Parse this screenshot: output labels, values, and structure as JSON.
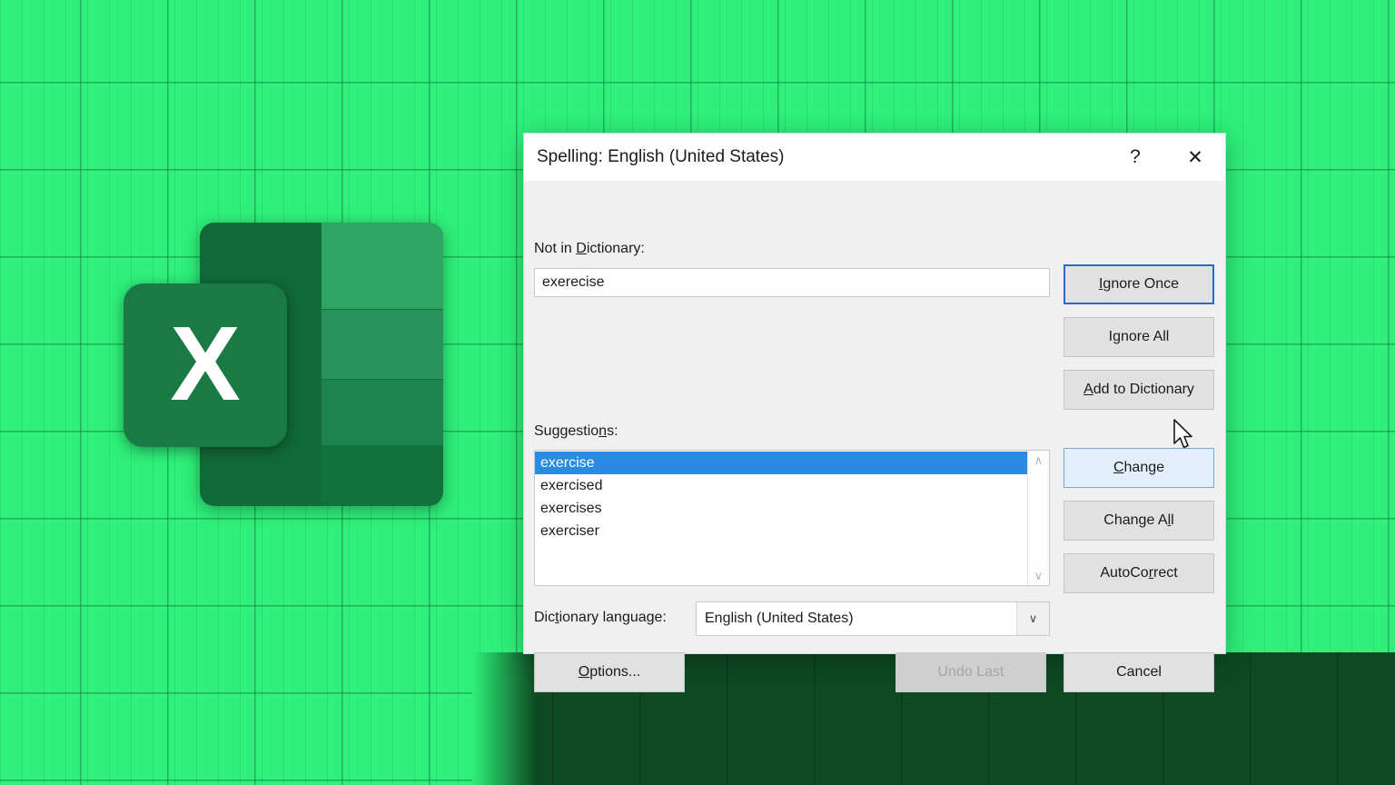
{
  "background": {
    "base_color": "#2ff07a",
    "grid_line_color": "#0a5a2d",
    "dark_panel_color": "#0d4a22"
  },
  "logo": {
    "name": "microsoft-excel-logo",
    "letter": "X",
    "sheet_color": "#12723c",
    "badge_color": "#197a44"
  },
  "dialog": {
    "title": "Spelling: English (United States)",
    "titlebar": {
      "help_glyph": "?",
      "close_glyph": "✕"
    },
    "not_in_dictionary": {
      "label_pre": "Not in ",
      "label_accel": "D",
      "label_post": "ictionary:",
      "value": "exerecise"
    },
    "suggestions": {
      "label_pre": "Suggestio",
      "label_accel": "n",
      "label_post": "s:",
      "items": [
        {
          "text": "exercise",
          "selected": true
        },
        {
          "text": "exercised",
          "selected": false
        },
        {
          "text": "exercises",
          "selected": false
        },
        {
          "text": "exerciser",
          "selected": false
        }
      ],
      "scroll_up_glyph": "∧",
      "scroll_down_glyph": "∨",
      "selected_color": "#2a8ae4"
    },
    "dictionary_language": {
      "label": "Dictionary language:",
      "value": "English (United States)",
      "dropdown_glyph": "∨"
    },
    "buttons": {
      "ignore_once": {
        "pre": "",
        "accel": "I",
        "post": "gnore Once",
        "state": "focused"
      },
      "ignore_all": {
        "pre": "I",
        "accel": "g",
        "post": "nore All",
        "state": "normal"
      },
      "add_to_dictionary": {
        "pre": "",
        "accel": "A",
        "post": "dd to Dictionary",
        "state": "normal"
      },
      "change": {
        "pre": "",
        "accel": "C",
        "post": "hange",
        "state": "hovered"
      },
      "change_all": {
        "pre": "Change A",
        "accel": "l",
        "post": "l",
        "state": "normal"
      },
      "autocorrect": {
        "pre": "AutoCo",
        "accel": "r",
        "post": "rect",
        "state": "normal"
      },
      "options": {
        "pre": "",
        "accel": "O",
        "post": "ptions...",
        "state": "normal"
      },
      "undo_last": {
        "pre": "Undo Last",
        "accel": "",
        "post": "",
        "state": "disabled"
      },
      "cancel": {
        "pre": "Cancel",
        "accel": "",
        "post": "",
        "state": "normal"
      }
    }
  },
  "cursor": {
    "type": "arrow-pointer"
  }
}
